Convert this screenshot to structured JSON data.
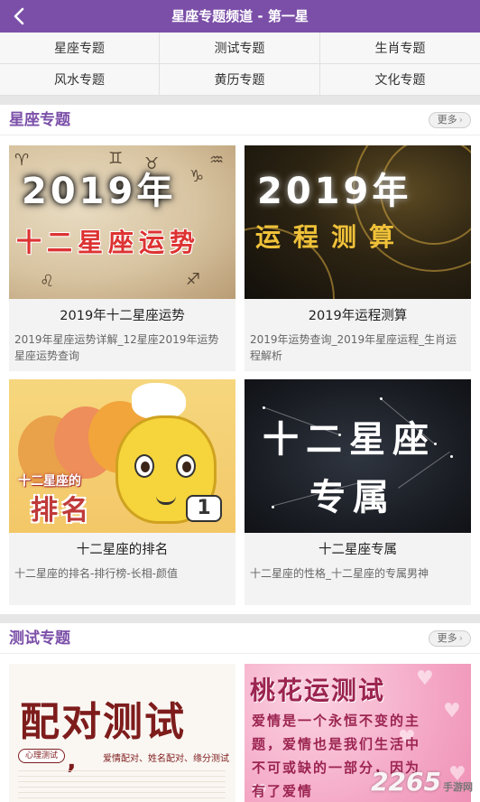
{
  "header": {
    "title": "星座专题频道 - 第一星",
    "back_icon": "chevron-left-icon",
    "bg_color": "#7b4fa8"
  },
  "categories": [
    {
      "label": "星座专题"
    },
    {
      "label": "测试专题"
    },
    {
      "label": "生肖专题"
    },
    {
      "label": "风水专题"
    },
    {
      "label": "黄历专题"
    },
    {
      "label": "文化专题"
    }
  ],
  "sections": [
    {
      "title": "星座专题",
      "more_label": "更多",
      "cards": [
        {
          "title": "2019年十二星座运势",
          "desc": "2019年星座运势详解_12星座2019年运势 星座运势查询",
          "art_en": "2019年",
          "art_cn": "十二星座运势"
        },
        {
          "title": "2019年运程测算",
          "desc": "2019年运势查询_2019年星座运程_生肖运程解析",
          "art_en": "2019年",
          "art_cn": "运程测算"
        },
        {
          "title": "十二星座的排名",
          "desc": "十二星座的排名-排行榜-长相-颜值",
          "art_small": "十二星座的",
          "art_big": "排名",
          "art_badge": "1"
        },
        {
          "title": "十二星座专属",
          "desc": "十二星座的性格_十二星座的专属男神",
          "art_line1": "十二星座",
          "art_line2": "专属"
        }
      ]
    },
    {
      "title": "测试专题",
      "more_label": "更多",
      "cards": [
        {
          "art_big": "配对测试",
          "art_pill": "心理测试",
          "art_sub": "爱情配对、姓名配对、缘分测试"
        },
        {
          "art_big": "桃花运测试",
          "art_lines": [
            "爱情是一个永恒不变的主",
            "题，爱情也是我们生活中",
            "不可或缺的一部分，因为",
            "有了爱情"
          ]
        }
      ]
    }
  ],
  "watermark": {
    "text": "2265",
    "suffix": "手游网"
  }
}
